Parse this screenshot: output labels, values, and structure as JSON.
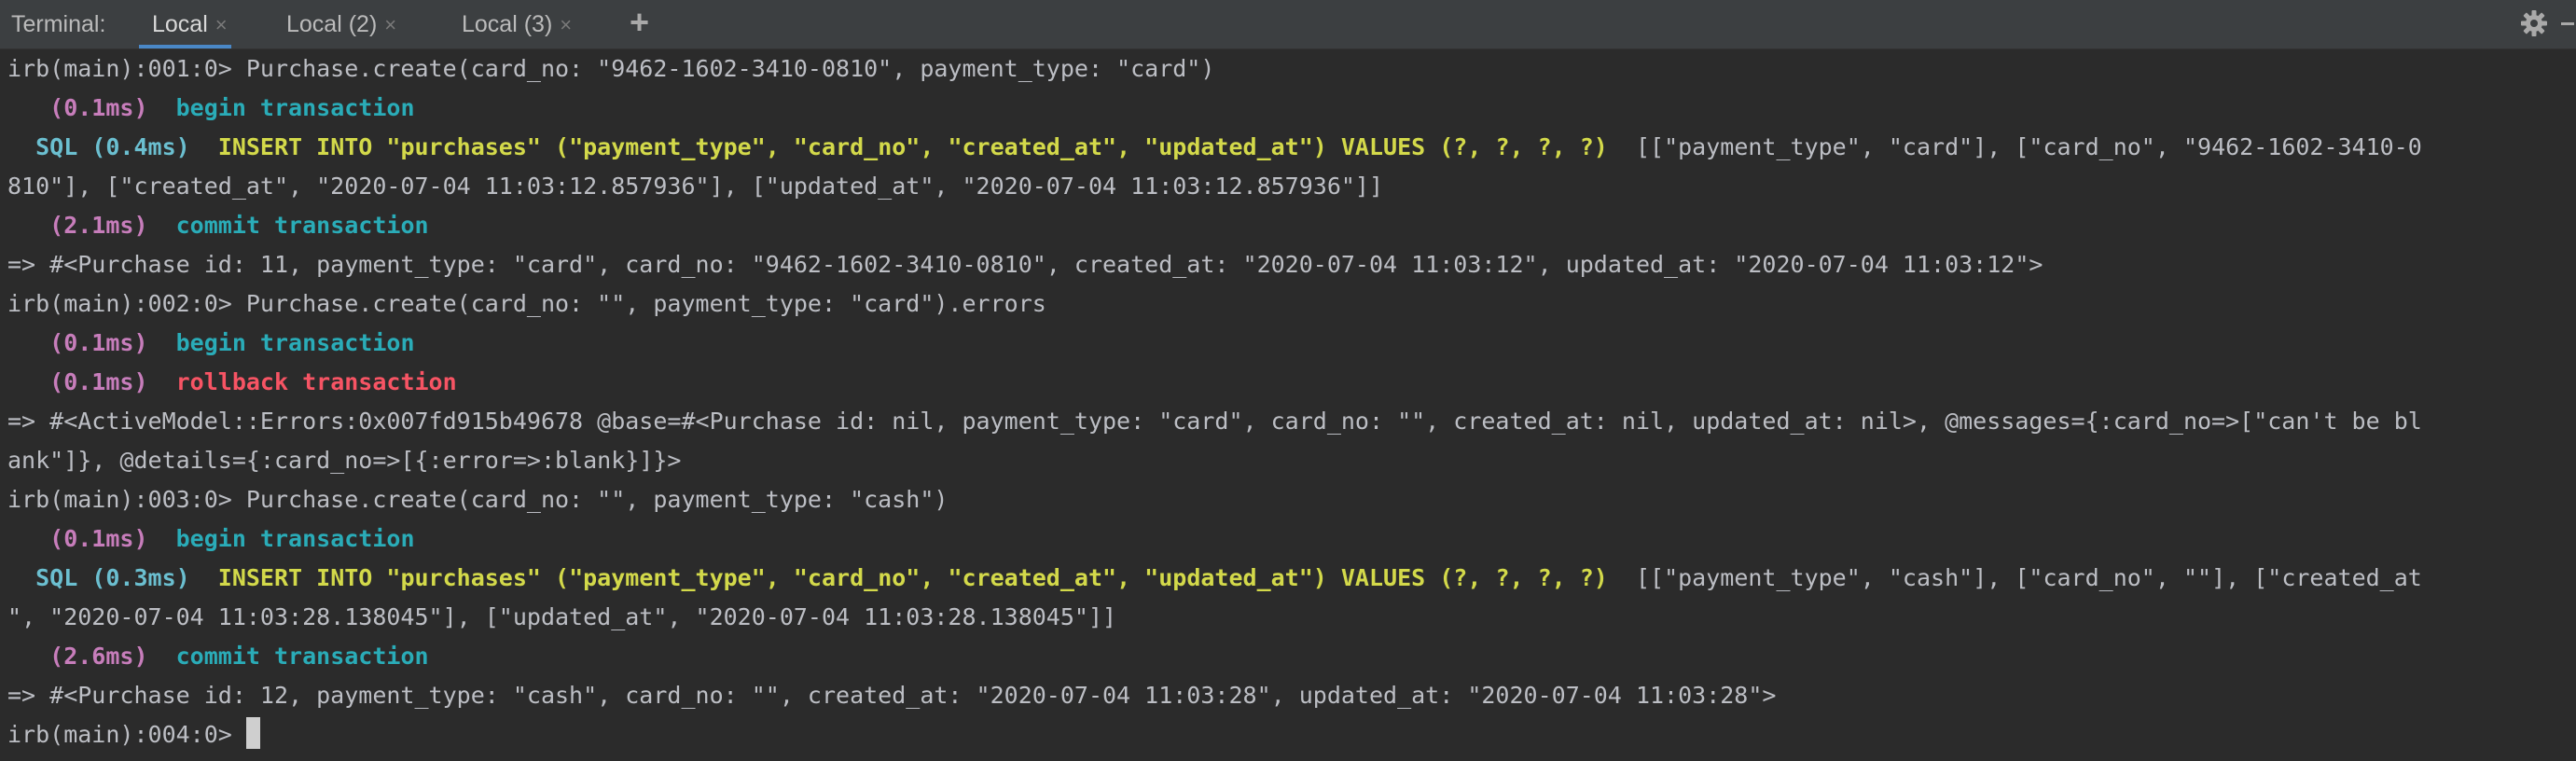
{
  "tabbar": {
    "label": "Terminal:",
    "tabs": [
      {
        "label": "Local",
        "active": true
      },
      {
        "label": "Local (2)",
        "active": false
      },
      {
        "label": "Local (3)",
        "active": false
      }
    ]
  },
  "icons": {
    "close": "×",
    "add": "+",
    "settings": "gear-icon",
    "minimize": "minimize-icon"
  },
  "colors": {
    "background": "#2b2b2b",
    "tabbar": "#3c3f41",
    "active_underline": "#4a88c7",
    "duration": "#c77dbb",
    "sql_keyword": "#d3d94a",
    "transaction": "#2aacb8",
    "rollback": "#f75464"
  },
  "terminal": {
    "l1": "irb(main):001:0> Purchase.create(card_no: \"9462-1602-3410-0810\", payment_type: \"card\")",
    "l2": {
      "dur": "   (0.1ms)",
      "msg": "begin transaction"
    },
    "l3": {
      "label": "  SQL (0.4ms)",
      "sql": "INSERT INTO \"purchases\" (\"payment_type\", \"card_no\", \"created_at\", \"updated_at\") VALUES (?, ?, ?, ?)",
      "rest": "  [[\"payment_type\", \"card\"], [\"card_no\", \"9462-1602-3410-0"
    },
    "l4": "810\"], [\"created_at\", \"2020-07-04 11:03:12.857936\"], [\"updated_at\", \"2020-07-04 11:03:12.857936\"]]",
    "l5": {
      "dur": "   (2.1ms)",
      "msg": "commit transaction"
    },
    "l6": "=> #<Purchase id: 11, payment_type: \"card\", card_no: \"9462-1602-3410-0810\", created_at: \"2020-07-04 11:03:12\", updated_at: \"2020-07-04 11:03:12\">",
    "l7": "irb(main):002:0> Purchase.create(card_no: \"\", payment_type: \"card\").errors",
    "l8": {
      "dur": "   (0.1ms)",
      "msg": "begin transaction"
    },
    "l9": {
      "dur": "   (0.1ms)",
      "msg": "rollback transaction"
    },
    "l10": "=> #<ActiveModel::Errors:0x007fd915b49678 @base=#<Purchase id: nil, payment_type: \"card\", card_no: \"\", created_at: nil, updated_at: nil>, @messages={:card_no=>[\"can't be bl",
    "l11": "ank\"]}, @details={:card_no=>[{:error=>:blank}]}>",
    "l12": "irb(main):003:0> Purchase.create(card_no: \"\", payment_type: \"cash\")",
    "l13": {
      "dur": "   (0.1ms)",
      "msg": "begin transaction"
    },
    "l14": {
      "label": "  SQL (0.3ms)",
      "sql": "INSERT INTO \"purchases\" (\"payment_type\", \"card_no\", \"created_at\", \"updated_at\") VALUES (?, ?, ?, ?)",
      "rest": "  [[\"payment_type\", \"cash\"], [\"card_no\", \"\"], [\"created_at"
    },
    "l15": "\", \"2020-07-04 11:03:28.138045\"], [\"updated_at\", \"2020-07-04 11:03:28.138045\"]]",
    "l16": {
      "dur": "   (2.6ms)",
      "msg": "commit transaction"
    },
    "l17": "=> #<Purchase id: 12, payment_type: \"cash\", card_no: \"\", created_at: \"2020-07-04 11:03:28\", updated_at: \"2020-07-04 11:03:28\">",
    "l18": "irb(main):004:0> "
  }
}
